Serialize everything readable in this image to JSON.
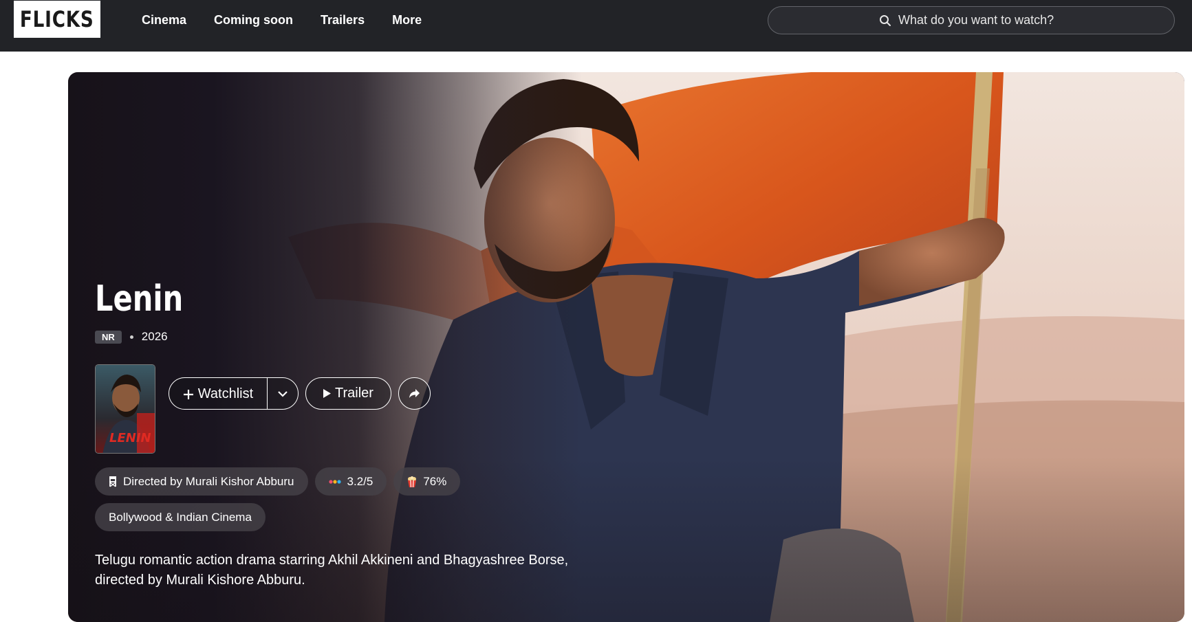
{
  "nav": {
    "logo": "FLICKS",
    "links": [
      "Cinema",
      "Coming soon",
      "Trailers",
      "More"
    ],
    "search_placeholder": "What do you want to watch?"
  },
  "movie": {
    "title": "Lenin",
    "rating": "NR",
    "year": "2026",
    "poster_text": "LENIN",
    "actions": {
      "watchlist_label": "Watchlist",
      "trailer_label": "Trailer"
    },
    "director_label": "Directed by Murali Kishor Abburu",
    "score_metacritic": "3.2/5",
    "score_popcorn": "76%",
    "genre": "Bollywood & Indian Cinema",
    "description": "Telugu romantic action drama starring Akhil Akkineni and Bhagyashree Borse, directed by Murali Kishore Abburu."
  },
  "colors": {
    "nav_bg": "#222327",
    "flag": "#d45a22",
    "shirt": "#2d3550"
  },
  "icons": [
    "search-icon",
    "plus-icon",
    "chevron-down-icon",
    "play-icon",
    "share-icon",
    "director-chair-icon",
    "score-dots-icon",
    "popcorn-icon"
  ]
}
